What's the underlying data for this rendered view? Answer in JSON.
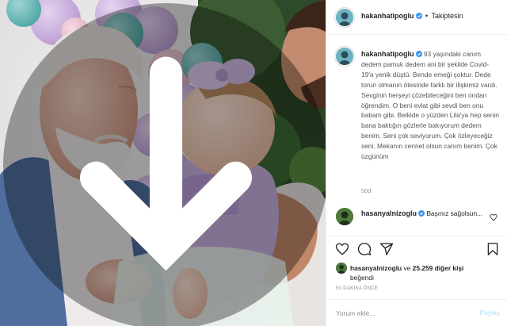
{
  "colors": {
    "accent": "#0095f6",
    "verified": "#3897f0",
    "post_disabled": "#b2dffc",
    "muted_text": "#8e8e8e",
    "divider": "#efefef"
  },
  "photo": {
    "multiple_media_icon": "download-arrow-icon"
  },
  "header": {
    "username": "hakanhatipoglu",
    "separator": "•",
    "follow_state": "Takiptesin"
  },
  "caption": {
    "username": "hakanhatipoglu",
    "text": "93 yaşındaki canım dedem pamuk dedem ani bir şekilde Covid-19'a yenik düştü. Bende emeği çoktur. Dede torun olmanın ötesinde farklı bir ilişkimiz vardı. Sevginin herşeyi çözebileceğini ben ondan öğrendim. O beni evlat gibi sevdi ben onu babam gibi. Belkide o yüzden Lila'ya hep senin bana baktığın gözlerle bakıyorum dedem benim. Seni çok seviyorum. Çok özleyeceğiz seni. Mekanın cennet olsun canım benim. Çok üzgünüm",
    "time_ago": "50d"
  },
  "comment": {
    "username": "hasanyalnizoglu",
    "text": "Başınız sağolsun..."
  },
  "actions": {
    "like_icon": "heart-icon",
    "comment_icon": "comment-bubble-icon",
    "share_icon": "paper-plane-icon",
    "save_icon": "bookmark-icon"
  },
  "likes": {
    "username": "hasanyalnizoglu",
    "connector": "ve",
    "count_text": "25.259 diğer kişi",
    "suffix": "beğendi"
  },
  "timestamp": "50 DAKİKA ÖNCE",
  "comment_box": {
    "placeholder": "Yorum ekle...",
    "post_label": "Paylaş"
  }
}
